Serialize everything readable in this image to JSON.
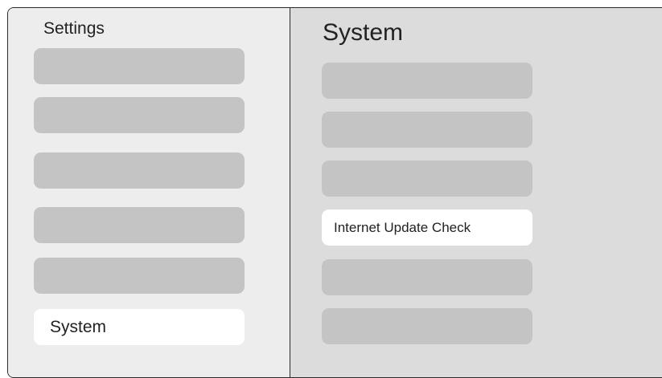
{
  "sidebar": {
    "title": "Settings",
    "items": [
      {
        "label": ""
      },
      {
        "label": ""
      },
      {
        "label": ""
      },
      {
        "label": ""
      },
      {
        "label": ""
      },
      {
        "label": "System",
        "selected": true
      }
    ]
  },
  "main": {
    "title": "System",
    "items": [
      {
        "label": ""
      },
      {
        "label": ""
      },
      {
        "label": ""
      },
      {
        "label": "Internet Update Check",
        "selected": true
      },
      {
        "label": ""
      },
      {
        "label": ""
      }
    ]
  },
  "colors": {
    "frame_border": "#2a2a2a",
    "sidebar_bg": "#ededed",
    "main_bg": "#dcdcdc",
    "tile": "#c4c4c4",
    "tile_selected": "#ffffff"
  }
}
